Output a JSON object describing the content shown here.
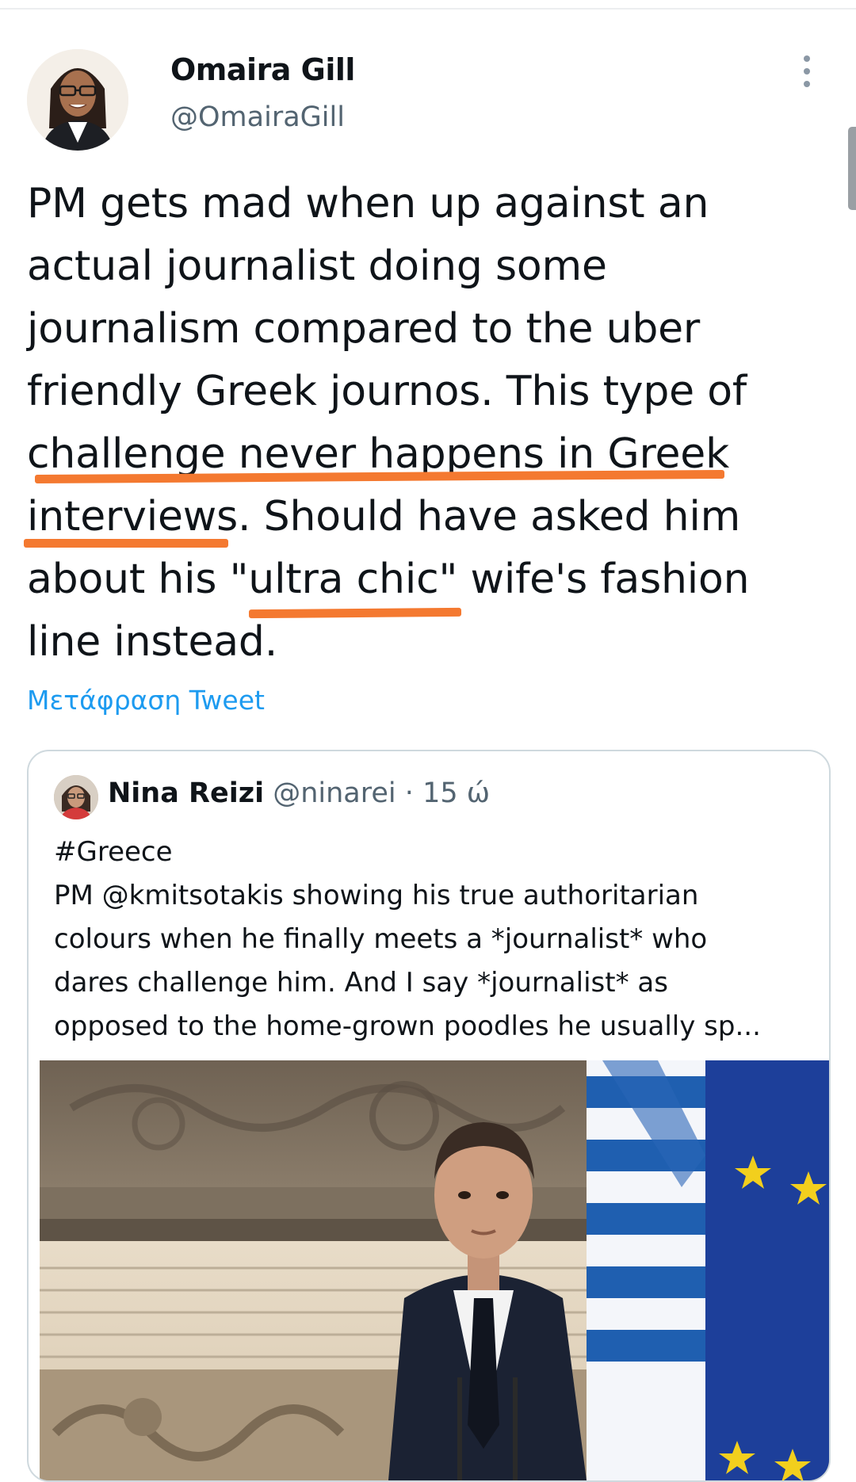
{
  "tweet": {
    "author_name": "Omaira Gill",
    "author_handle": "@OmairaGill",
    "text_lines": [
      "PM gets mad when up against an",
      "actual journalist doing some",
      "journalism compared to the uber",
      "friendly Greek journos. This type of",
      "challenge never happens in Greek",
      "interviews. Should have asked him",
      "about his \"ultra chic\" wife's fashion",
      "line instead."
    ],
    "translate_label": "Μετάφραση Tweet",
    "underline_color": "#f47930"
  },
  "quoted_tweet": {
    "author_name": "Nina Reizi",
    "author_handle": "@ninarei",
    "separator": "·",
    "time": "15 ώ",
    "text_lines": [
      "#Greece",
      "PM @kmitsotakis showing his true authoritarian",
      "colours when he finally meets a *journalist* who",
      "dares challenge him. And  I say *journalist* as",
      "opposed to the home-grown poodles he usually sp..."
    ]
  },
  "icons": {
    "more": "more-vertical-icon"
  },
  "colors": {
    "link": "#1d9bf0",
    "secondary_text": "#536471",
    "border": "#cfd9de"
  }
}
